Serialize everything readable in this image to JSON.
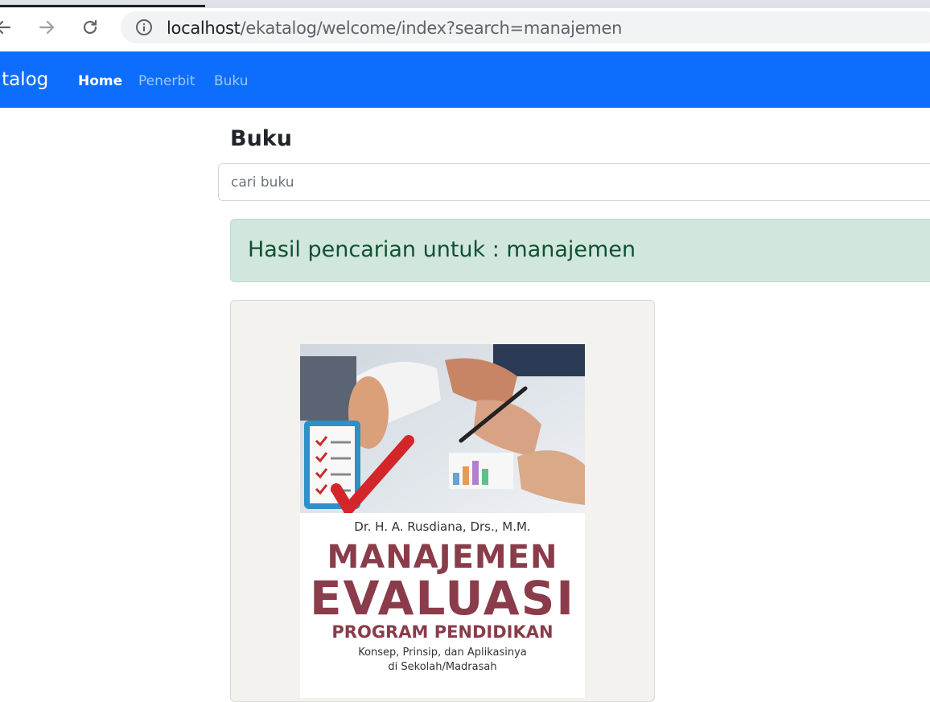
{
  "browser": {
    "url_host": "localhost",
    "url_path": "/ekatalog/welcome/index?search=manajemen"
  },
  "navbar": {
    "brand": "atalog",
    "links": [
      {
        "label": "Home",
        "active": true
      },
      {
        "label": "Penerbit",
        "active": false
      },
      {
        "label": "Buku",
        "active": false
      }
    ]
  },
  "main": {
    "title": "Buku",
    "search_placeholder": "cari buku",
    "result_message": "Hasil pencarian untuk : manajemen"
  },
  "book": {
    "author": "Dr. H. A. Rusdiana, Drs., M.M.",
    "title_line1": "MANAJEMEN",
    "title_line2": "EVALUASI",
    "subtitle": "PROGRAM PENDIDIKAN",
    "desc_line1": "Konsep, Prinsip, dan Aplikasinya",
    "desc_line2": "di Sekolah/Madrasah"
  },
  "colors": {
    "navbar": "#0d6efd",
    "alert_bg": "#d1e7dd",
    "alert_text": "#0f5132",
    "cover_title": "#8a3c4a"
  }
}
